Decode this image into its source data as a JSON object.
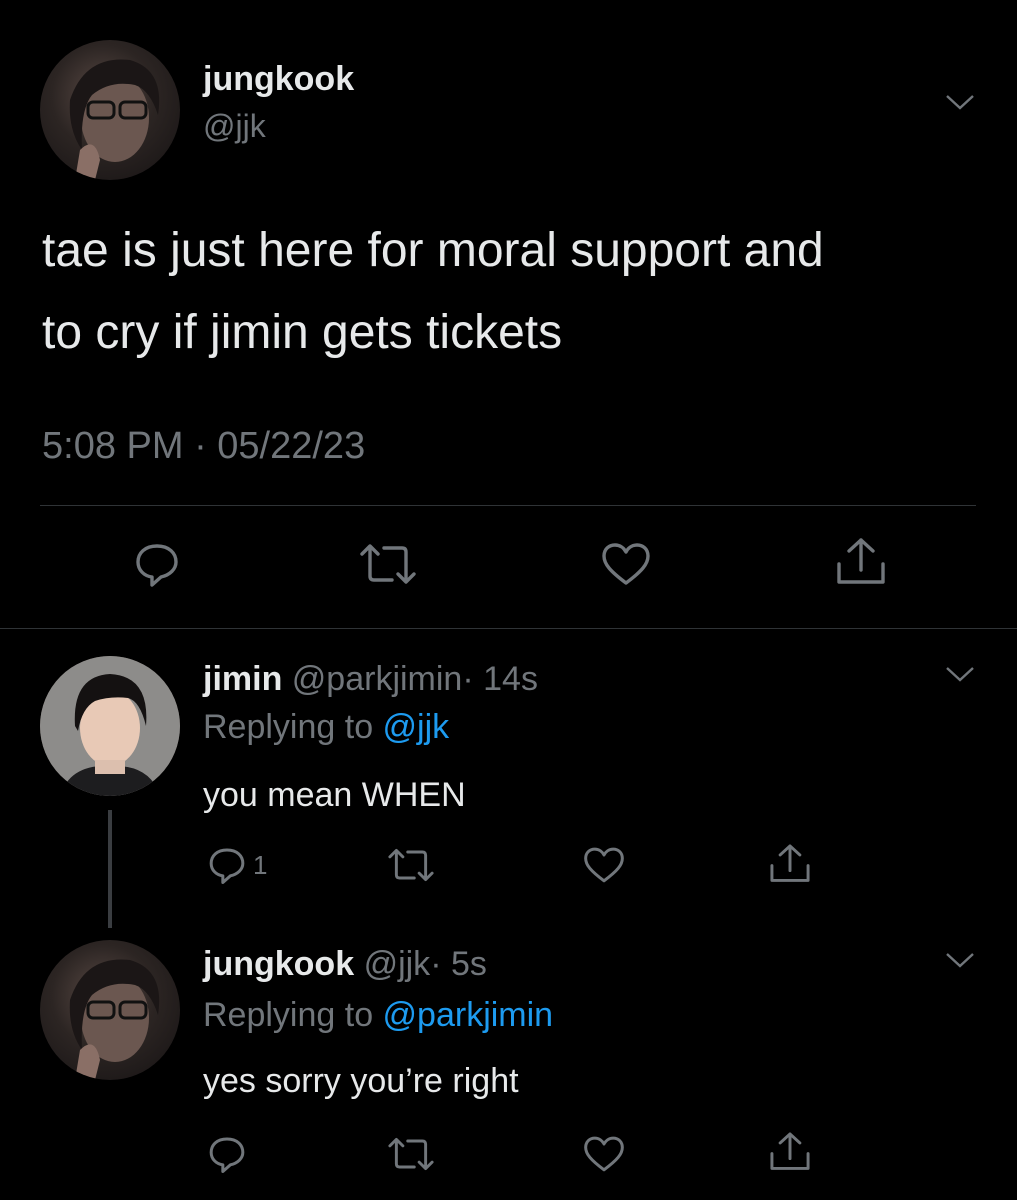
{
  "main_tweet": {
    "display_name": "jungkook",
    "handle": "@jjk",
    "text_line1": "tae is just here for moral support and",
    "text_line2": "to cry if jimin gets tickets",
    "timestamp": "5:08 PM · 05/22/23"
  },
  "replies": [
    {
      "display_name": "jimin",
      "handle": "@parkjimin",
      "age": "· 14s",
      "replying_prefix": "Replying to ",
      "replying_to": "@jjk",
      "text": "you mean WHEN",
      "reply_count": "1"
    },
    {
      "display_name": "jungkook",
      "handle": "@jjk",
      "age": "· 5s",
      "replying_prefix": "Replying to ",
      "replying_to": "@parkjimin",
      "text": "yes sorry you’re right",
      "reply_count": ""
    }
  ],
  "icons": {
    "reply": "reply-icon",
    "retweet": "retweet-icon",
    "like": "heart-icon",
    "share": "share-icon",
    "menu": "chevron-down-icon"
  },
  "colors": {
    "background": "#000000",
    "text": "#e7e9ea",
    "muted": "#71767b",
    "link": "#1d9bf0",
    "divider": "#2f3336"
  }
}
